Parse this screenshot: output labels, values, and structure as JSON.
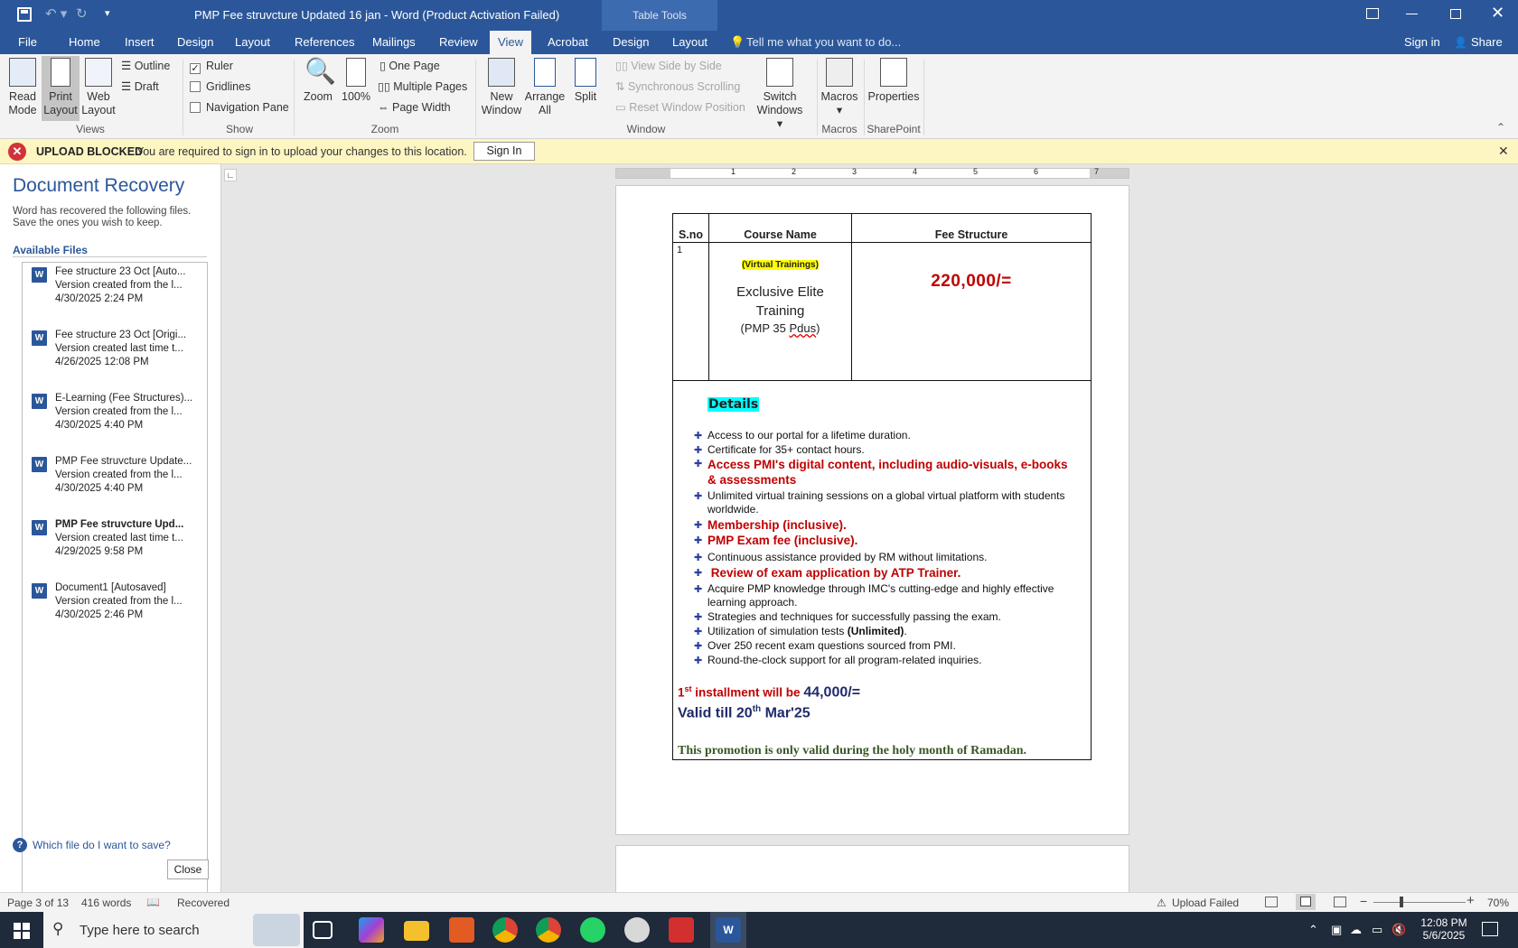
{
  "window": {
    "title": "PMP Fee struvcture Updated 16 jan - Word (Product Activation Failed)",
    "context": "Table Tools"
  },
  "menu": {
    "file": "File",
    "tabs": [
      "Home",
      "Insert",
      "Design",
      "Layout",
      "References",
      "Mailings",
      "Review",
      "View",
      "Acrobat"
    ],
    "context_tabs": [
      "Design",
      "Layout"
    ],
    "tellme": "Tell me what you want to do...",
    "signin": "Sign in",
    "share": "Share"
  },
  "ribbon": {
    "views": {
      "read": [
        "Read",
        "Mode"
      ],
      "print": [
        "Print",
        "Layout"
      ],
      "web": [
        "Web",
        "Layout"
      ],
      "outline": "Outline",
      "draft": "Draft",
      "label": "Views"
    },
    "show": {
      "ruler": "Ruler",
      "gridlines": "Gridlines",
      "nav": "Navigation Pane",
      "label": "Show"
    },
    "zoom": {
      "zoom": "Zoom",
      "pct": "100%",
      "one": "One Page",
      "multi": "Multiple Pages",
      "width": "Page Width",
      "label": "Zoom"
    },
    "window": {
      "new": [
        "New",
        "Window"
      ],
      "arrange": [
        "Arrange",
        "All"
      ],
      "split": "Split",
      "side": "View Side by Side",
      "sync": "Synchronous Scrolling",
      "reset": "Reset Window Position",
      "switch": [
        "Switch",
        "Windows"
      ],
      "label": "Window"
    },
    "macros": {
      "btn": "Macros",
      "label": "Macros"
    },
    "sharepoint": {
      "btn": "Properties",
      "label": "SharePoint"
    }
  },
  "bizbar": {
    "title": "UPLOAD BLOCKED",
    "message": "You are required to sign in to upload your changes to this location.",
    "button": "Sign In"
  },
  "recovery": {
    "title": "Document Recovery",
    "desc1": "Word has recovered the following files.",
    "desc2": "Save the ones you wish to keep.",
    "available": "Available Files",
    "files": [
      {
        "name": "Fee structure 23 Oct  [Auto...",
        "desc": "Version created from the l...",
        "date": "4/30/2025 2:24 PM"
      },
      {
        "name": "Fee structure 23 Oct  [Origi...",
        "desc": "Version created last time t...",
        "date": "4/26/2025 12:08 PM"
      },
      {
        "name": "E-Learning (Fee Structures)...",
        "desc": "Version created from the l...",
        "date": "4/30/2025 4:40 PM"
      },
      {
        "name": "PMP Fee struvcture Update...",
        "desc": "Version created from the l...",
        "date": "4/30/2025 4:40 PM"
      },
      {
        "name": "PMP Fee struvcture Upd...",
        "desc": "Version created last time t...",
        "date": "4/29/2025 9:58 PM"
      },
      {
        "name": "Document1  [Autosaved]",
        "desc": "Version created from the l...",
        "date": "4/30/2025 2:46 PM"
      }
    ],
    "help": "Which file do I want to save?",
    "close": "Close"
  },
  "ruler": {
    "marks": [
      "1",
      "2",
      "3",
      "4",
      "5",
      "6",
      "7"
    ]
  },
  "doc": {
    "th_sno": "S.no",
    "th_course": "Course Name",
    "th_fee": "Fee Structure",
    "sno": "1",
    "virtual": "(Virtual Trainings)",
    "course1": "Exclusive Elite",
    "course2": "Training",
    "pdus_pre": "(PMP 35 ",
    "pdus_word": "Pdus",
    "pdus_post": ")",
    "fee": "220,000/=",
    "details": "Details",
    "bullets": [
      "Access to our portal for a lifetime duration.",
      "Certificate for 35+ contact hours.",
      "Access PMI's digital content, including audio-visuals, e-books & assessments",
      "Unlimited virtual training sessions on a global virtual platform with students worldwide.",
      "Membership (inclusive).",
      "PMP Exam fee (inclusive).",
      "Continuous assistance provided by RM without limitations.",
      " Review of exam application by ATP Trainer.",
      "Acquire PMP knowledge through IMC's cutting-edge and highly effective learning approach.",
      "Strategies and techniques for successfully passing the exam.",
      "Utilization of simulation tests ",
      "Over 250 recent exam questions sourced from PMI.",
      "Round-the-clock support for all program-related inquiries."
    ],
    "unlimited": "(Unlimited)",
    "period": ".",
    "inst_num": "1",
    "inst_sup": "st",
    "inst_text": " installment will be ",
    "inst_amt": "44,000/=",
    "valid_pre": "Valid till 20",
    "valid_sup": "th",
    "valid_post": " Mar'25",
    "promo": "This promotion is only valid during the holy month of Ramadan."
  },
  "status": {
    "page": "Page 3 of 13",
    "words": "416 words",
    "recovered": "Recovered",
    "upload": "Upload Failed",
    "zoom": "70%"
  },
  "taskbar": {
    "search": "Type here to search",
    "time": "12:08 PM",
    "date": "5/6/2025"
  }
}
